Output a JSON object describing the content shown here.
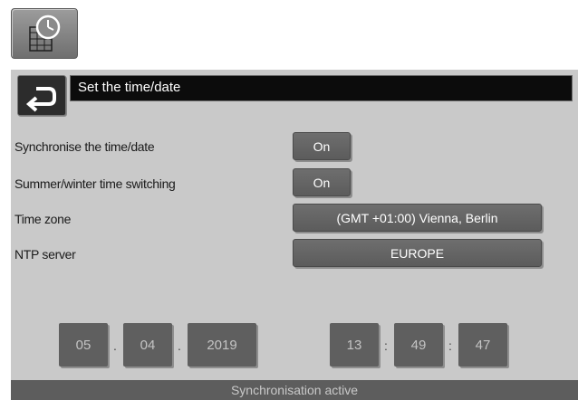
{
  "header": {
    "title": "Set the time/date",
    "icon": "clock-calendar-icon",
    "back_icon": "back-arrow-icon"
  },
  "settings": [
    {
      "label": "Synchronise the time/date",
      "value": "On"
    },
    {
      "label": "Summer/winter time switching",
      "value": "On"
    },
    {
      "label": "Time zone",
      "value": "(GMT +01:00) Vienna, Berlin"
    },
    {
      "label": "NTP server",
      "value": "EUROPE"
    }
  ],
  "date": {
    "day": "05",
    "month": "04",
    "year": "2019",
    "separator": "."
  },
  "time": {
    "hours": "13",
    "minutes": "49",
    "seconds": "47",
    "separator": ":"
  },
  "status": "Synchronisation active",
  "colors": {
    "panel": "#c9c9c9",
    "title_bar": "#0c0c0c",
    "button": "#666666",
    "status_bar": "#5d5d5d"
  }
}
